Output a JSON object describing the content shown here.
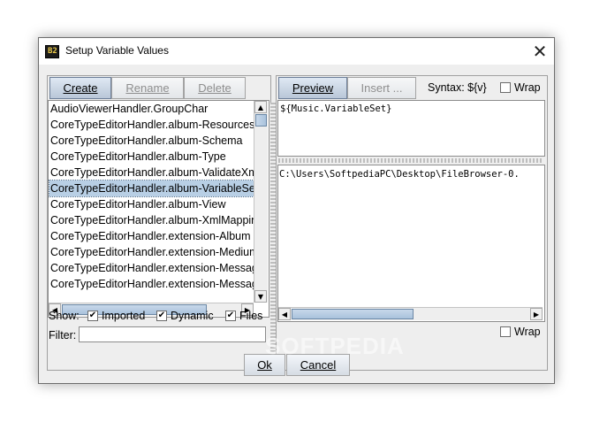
{
  "window": {
    "title": "Setup Variable Values",
    "icon_text": "B2"
  },
  "left": {
    "buttons": {
      "create": "Create",
      "rename": "Rename",
      "delete": "Delete"
    },
    "items": [
      "AudioViewerHandler.GroupChar",
      "CoreTypeEditorHandler.album-Resources",
      "CoreTypeEditorHandler.album-Schema",
      "CoreTypeEditorHandler.album-Type",
      "CoreTypeEditorHandler.album-ValidateXml",
      "CoreTypeEditorHandler.album-VariableSet",
      "CoreTypeEditorHandler.album-View",
      "CoreTypeEditorHandler.album-XmlMapping",
      "CoreTypeEditorHandler.extension-Album",
      "CoreTypeEditorHandler.extension-Medium",
      "CoreTypeEditorHandler.extension-Message",
      "CoreTypeEditorHandler.extension-Message"
    ],
    "selected_index": 5,
    "show_label": "Show:",
    "filters": {
      "imported": "Imported",
      "dynamic": "Dynamic",
      "files": "Files"
    },
    "filter_label": "Filter:",
    "filter_value": ""
  },
  "right": {
    "buttons": {
      "preview": "Preview",
      "insert": "Insert ..."
    },
    "syntax_label": "Syntax: ${v}",
    "wrap_label": "Wrap",
    "expression": "${Music.VariableSet}",
    "result": "C:\\Users\\SoftpediaPC\\Desktop\\FileBrowser-0.",
    "wrap_bottom_label": "Wrap"
  },
  "footer": {
    "ok": "Ok",
    "cancel": "Cancel"
  },
  "watermark": "SOFTPEDIA"
}
